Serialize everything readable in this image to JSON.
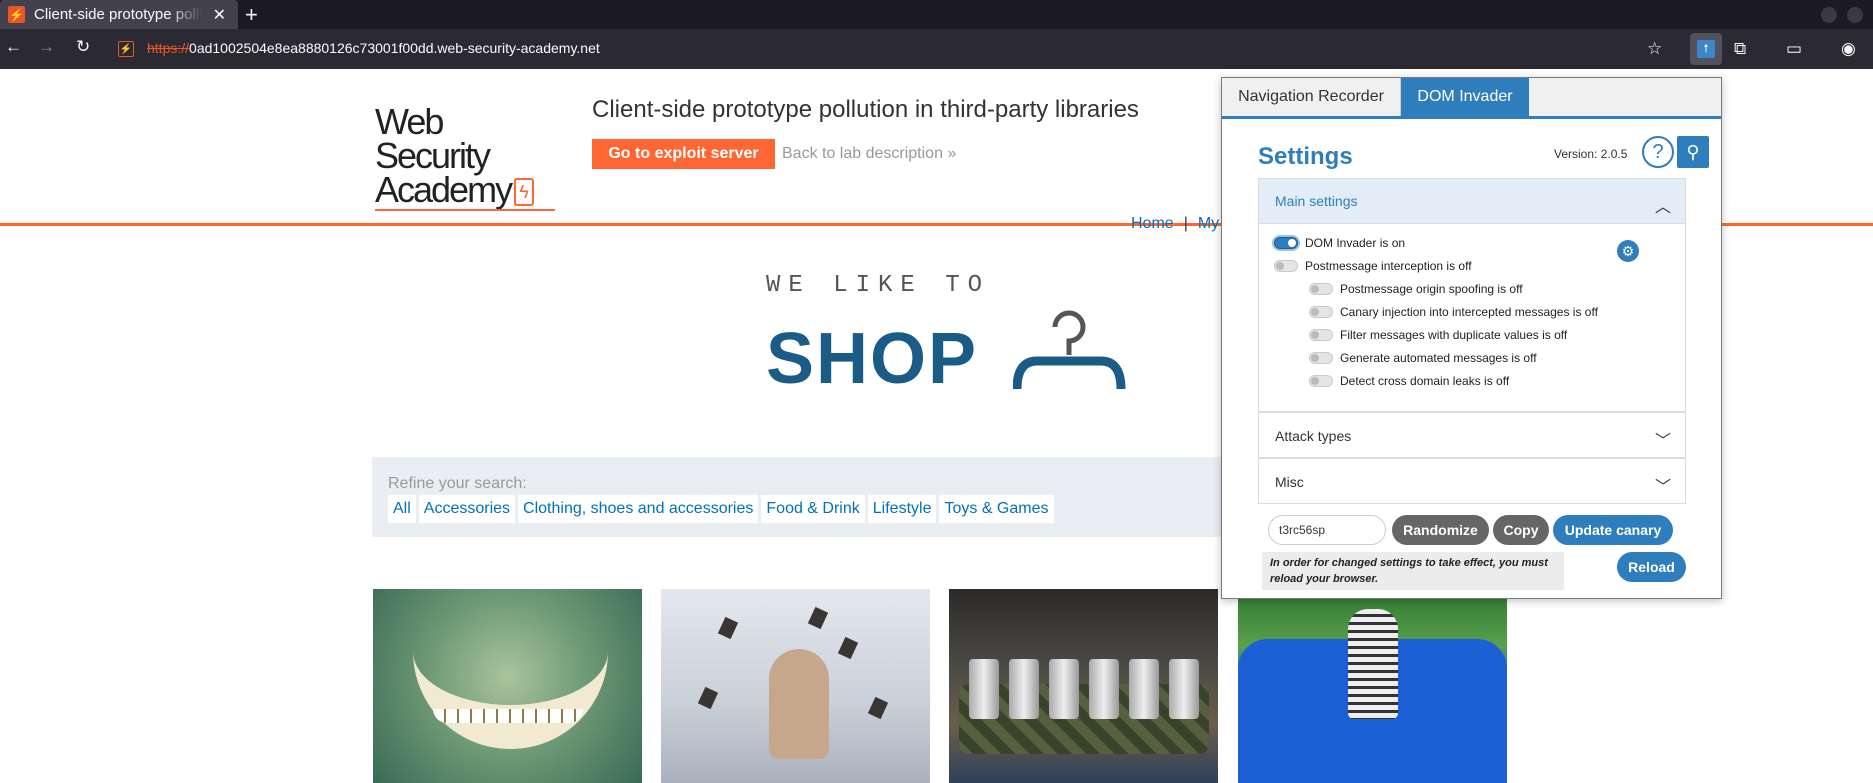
{
  "browser": {
    "tab_title": "Client-side prototype pollution in third-party libraries",
    "favicon": "⚡",
    "url_scheme": "https://",
    "url_host": "0ad1002504e8ea8880126c73001f00dd.web-security-academy.net"
  },
  "header": {
    "logo_line1": "Web Security",
    "logo_line2": "Academy",
    "lab_title": "Client-side prototype pollution in third-party libraries",
    "exploit_button": "Go to exploit server",
    "back_link": "Back to lab description",
    "back_chevron": "»"
  },
  "topnav": {
    "home": "Home",
    "separator": "|",
    "my_account": "My"
  },
  "shop_logo": {
    "tagline": "WE LIKE TO",
    "word": "SHOP"
  },
  "search": {
    "label": "Refine your search:",
    "filters": [
      "All",
      "Accessories",
      "Clothing, shoes and accessories",
      "Food & Drink",
      "Lifestyle",
      "Toys & Games"
    ]
  },
  "panel": {
    "tabs": [
      "Navigation Recorder",
      "DOM Invader"
    ],
    "heading": "Settings",
    "version": "Version: 2.0.5",
    "help_glyph": "?",
    "main_settings_label": "Main settings",
    "toggles": [
      {
        "label": "DOM Invader is on",
        "on": true
      },
      {
        "label": "Postmessage interception is off",
        "on": false
      },
      {
        "label": "Postmessage origin spoofing is off",
        "on": false
      },
      {
        "label": "Canary injection into intercepted messages is off",
        "on": false
      },
      {
        "label": "Filter messages with duplicate values is off",
        "on": false
      },
      {
        "label": "Generate automated messages is off",
        "on": false
      },
      {
        "label": "Detect cross domain leaks is off",
        "on": false
      }
    ],
    "attack_types_label": "Attack types",
    "misc_label": "Misc",
    "canary_value": "t3rc56sp",
    "randomize": "Randomize",
    "copy": "Copy",
    "update_canary": "Update canary",
    "note": "In order for changed settings to take effect, you must reload your browser.",
    "reload": "Reload"
  },
  "colors": {
    "accent": "#2e7ebd",
    "brand_orange": "#ff6633",
    "link": "#0071bc"
  }
}
